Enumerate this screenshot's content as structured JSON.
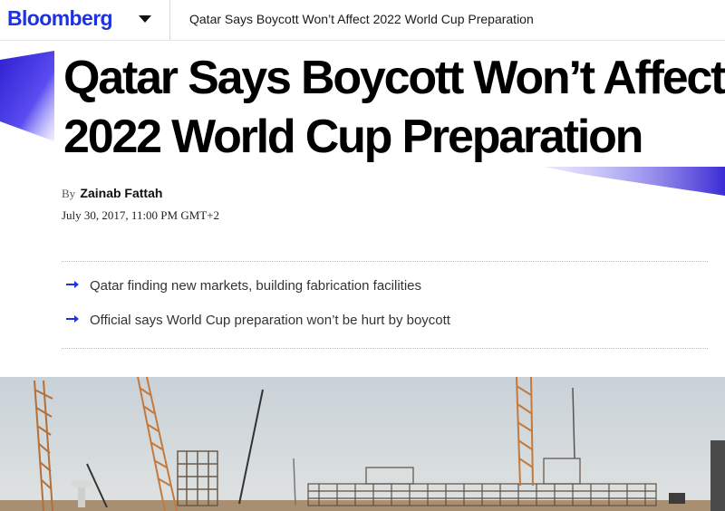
{
  "header": {
    "brand": "Bloomberg",
    "article_title": "Qatar Says Boycott Won’t Affect 2022 World Cup Preparation"
  },
  "article": {
    "headline_line1": "Qatar Says Boycott Won’t Affect",
    "headline_line2": "2022 World Cup Preparation",
    "by_prefix": "By",
    "author": "Zainab Fattah",
    "date": "July 30, 2017, 11:00 PM GMT+2",
    "bullets": [
      {
        "text": "Qatar finding new markets, building fabrication facilities"
      },
      {
        "text": "Official says World Cup preparation won’t be hurt by boycott"
      }
    ]
  },
  "colors": {
    "brand": "#1f32e0",
    "accent_gradient_start": "#3b2bd4",
    "accent_gradient_end": "#b9b2ff"
  },
  "icons": {
    "caret": "chevron-down-icon",
    "bullet": "arrow-right-icon"
  }
}
